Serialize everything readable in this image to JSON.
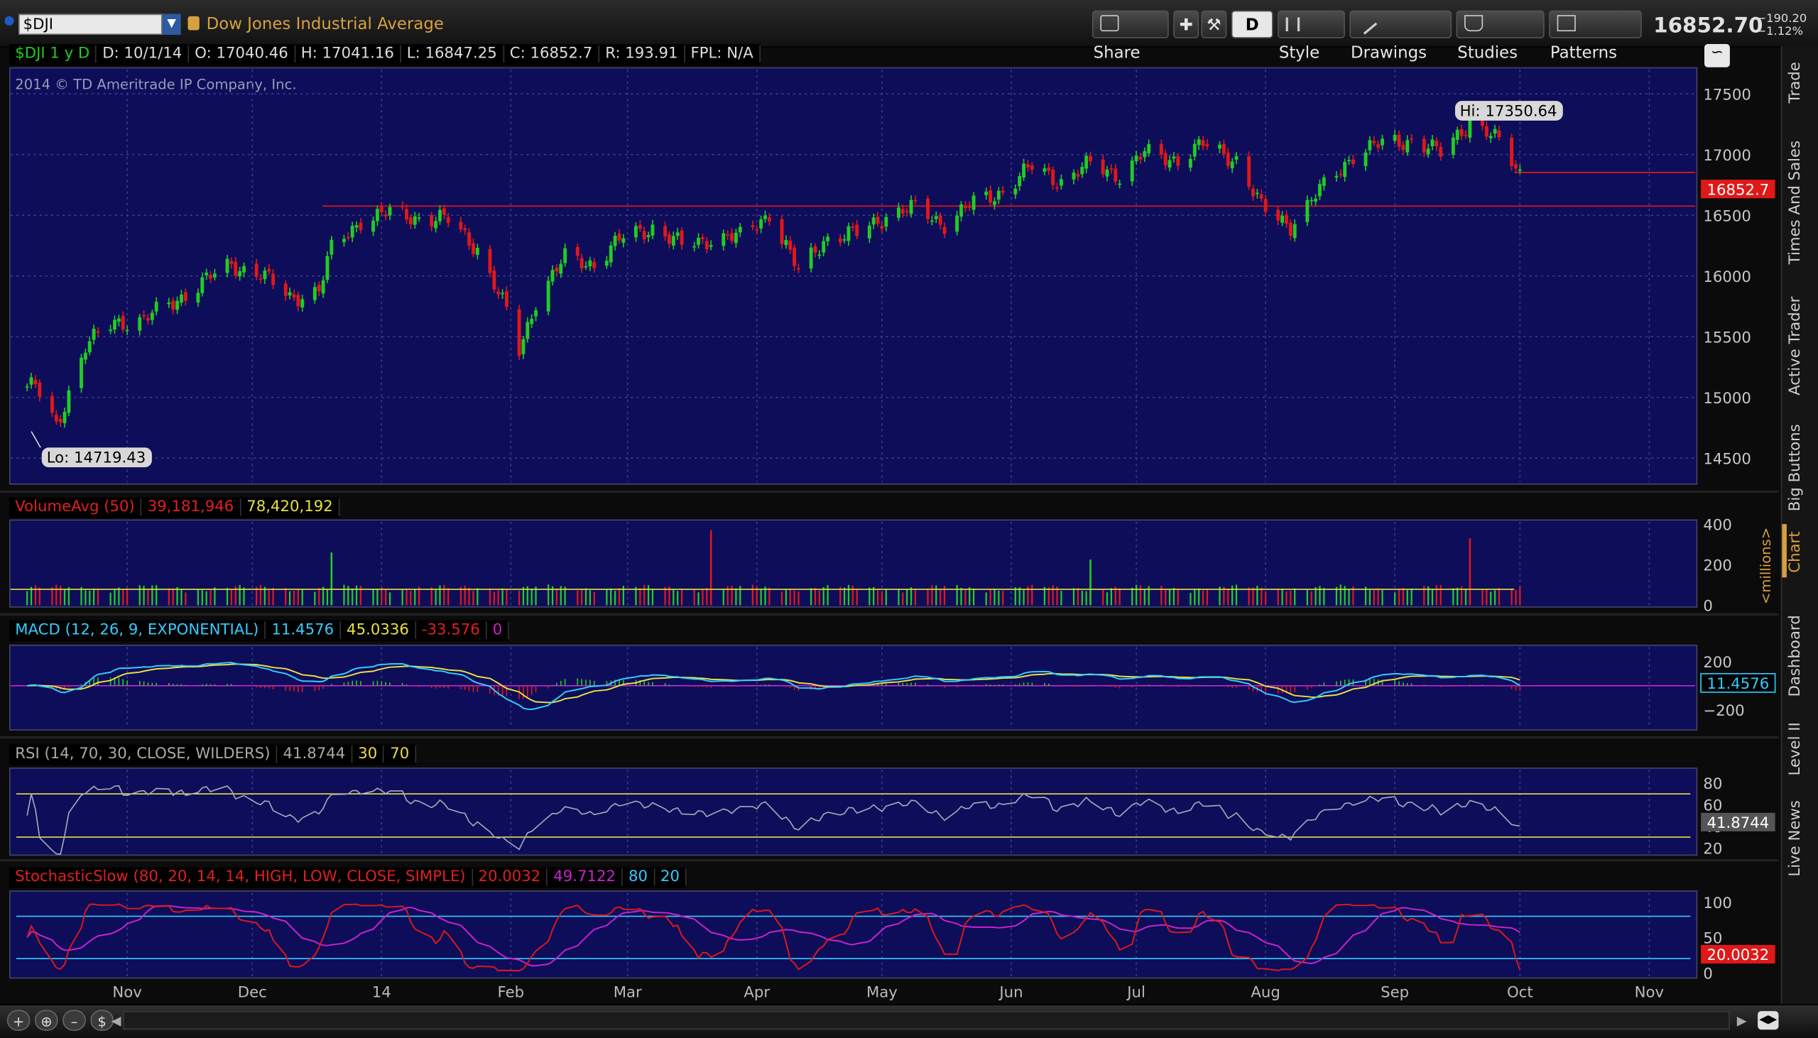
{
  "toolbar": {
    "symbol": "$DJI",
    "description": "Dow Jones Industrial Average",
    "share": "Share",
    "aggregation": "D",
    "style": "Style",
    "drawings": "Drawings",
    "studies": "Studies",
    "patterns": "Patterns",
    "last_price": "16852.70",
    "net_change": "−190.20",
    "pct_change": "−1.12%"
  },
  "header": {
    "symbol_period": "$DJI 1 y D",
    "date": "D: 10/1/14",
    "open": "O: 17040.46",
    "high": "H: 17041.16",
    "low": "L: 16847.25",
    "close": "C: 16852.7",
    "range": "R: 193.91",
    "fpl": "FPL: N/A"
  },
  "price_pane": {
    "copyright": "2014 © TD Ameritrade IP Company, Inc.",
    "hi_label": "Hi: 17350.64",
    "lo_label": "Lo: 14719.43",
    "last_label": "16852.7",
    "y_ticks": [
      "17500",
      "17000",
      "16500",
      "16000",
      "15500",
      "15000",
      "14500"
    ]
  },
  "volume_pane": {
    "study": "VolumeAvg (50)",
    "v1": "39,181,946",
    "v2": "78,420,192",
    "y_ticks": [
      "400",
      "200",
      "0"
    ],
    "unit": "<millions>"
  },
  "macd_pane": {
    "study": "MACD (12, 26, 9, EXPONENTIAL)",
    "v1": "11.4576",
    "v2": "45.0336",
    "v3": "-33.576",
    "v4": "0",
    "y_ticks": [
      "200",
      "−200"
    ],
    "last_label": "11.4576"
  },
  "rsi_pane": {
    "study": "RSI (14, 70, 30, CLOSE, WILDERS)",
    "v1": "41.8744",
    "v2": "30",
    "v3": "70",
    "y_ticks": [
      "80",
      "60",
      "40",
      "20"
    ],
    "last_label": "41.8744"
  },
  "stoch_pane": {
    "study": "StochasticSlow (80, 20, 14, 14, HIGH, LOW, CLOSE, SIMPLE)",
    "v1": "20.0032",
    "v2": "49.7122",
    "v3": "80",
    "v4": "20",
    "y_ticks": [
      "100",
      "50",
      "0"
    ],
    "last_label": "20.0032"
  },
  "x_axis": [
    "Nov",
    "Dec",
    "14",
    "Feb",
    "Mar",
    "Apr",
    "May",
    "Jun",
    "Jul",
    "Aug",
    "Sep",
    "Oct",
    "Nov"
  ],
  "sidebar_tabs": [
    "Trade",
    "Times And Sales",
    "Active Trader",
    "Big Buttons",
    "Chart",
    "Dashboard",
    "Level II",
    "Live News"
  ],
  "bottombar": {
    "dollar": "$"
  },
  "colors": {
    "pane_bg": "#0d0d5a",
    "up": "#22cc22",
    "down": "#e01818",
    "macd": "#33ccff",
    "signal": "#e8e040",
    "stoch_k": "#e01818",
    "stoch_d": "#cc22cc",
    "accent": "#d8a040"
  },
  "chart_data": {
    "type": "line",
    "title": "$DJI 1 y D",
    "x": [
      "2013-10-10",
      "2013-10-15",
      "2013-10-22",
      "2013-10-29",
      "2013-11-05",
      "2013-11-12",
      "2013-11-19",
      "2013-11-26",
      "2013-12-03",
      "2013-12-10",
      "2013-12-17",
      "2013-12-20",
      "2013-12-27",
      "2014-01-03",
      "2014-01-10",
      "2014-01-17",
      "2014-01-24",
      "2014-01-31",
      "2014-02-03",
      "2014-02-07",
      "2014-02-14",
      "2014-02-21",
      "2014-02-28",
      "2014-03-07",
      "2014-03-14",
      "2014-03-21",
      "2014-03-28",
      "2014-04-04",
      "2014-04-11",
      "2014-04-17",
      "2014-04-25",
      "2014-05-02",
      "2014-05-09",
      "2014-05-16",
      "2014-05-23",
      "2014-05-30",
      "2014-06-06",
      "2014-06-13",
      "2014-06-20",
      "2014-06-27",
      "2014-07-03",
      "2014-07-11",
      "2014-07-17",
      "2014-07-25",
      "2014-07-31",
      "2014-08-07",
      "2014-08-14",
      "2014-08-22",
      "2014-08-29",
      "2014-09-05",
      "2014-09-12",
      "2014-09-19",
      "2014-09-26",
      "2014-10-01"
    ],
    "series": [
      {
        "name": "$DJI",
        "values": [
          15090,
          14760,
          15420,
          15620,
          15640,
          15780,
          15950,
          16090,
          16020,
          15820,
          15880,
          16220,
          16460,
          16520,
          16480,
          16460,
          16230,
          15700,
          15380,
          15800,
          16150,
          16100,
          16320,
          16400,
          16250,
          16310,
          16320,
          16520,
          16030,
          16300,
          16350,
          16500,
          16560,
          16430,
          16600,
          16700,
          16900,
          16780,
          16920,
          16830,
          17010,
          16960,
          17080,
          16960,
          16560,
          16420,
          16700,
          17000,
          17090,
          17120,
          17010,
          17280,
          17100,
          16853
        ]
      }
    ],
    "ylim": [
      14300,
      17700
    ],
    "hi": 17350.64,
    "lo": 14719.43,
    "resistance": 16575,
    "last": 16852.7,
    "volume_ylim": [
      0,
      400
    ],
    "volume_spikes": [
      {
        "date": "2013-12-20",
        "value": 260
      },
      {
        "date": "2014-03-21",
        "value": 370
      },
      {
        "date": "2014-06-20",
        "value": 225
      },
      {
        "date": "2014-09-19",
        "value": 330
      }
    ],
    "volume_avg": 78.4,
    "macd_ylim": [
      -350,
      300
    ],
    "macd_last": 11.4576,
    "rsi_ylim": [
      15,
      90
    ],
    "rsi_levels": [
      70,
      30
    ],
    "rsi_last": 41.8744,
    "stoch_ylim": [
      -5,
      110
    ],
    "stoch_levels": [
      80,
      20
    ],
    "stoch_k_last": 20.0032,
    "stoch_d_last": 49.7122
  }
}
